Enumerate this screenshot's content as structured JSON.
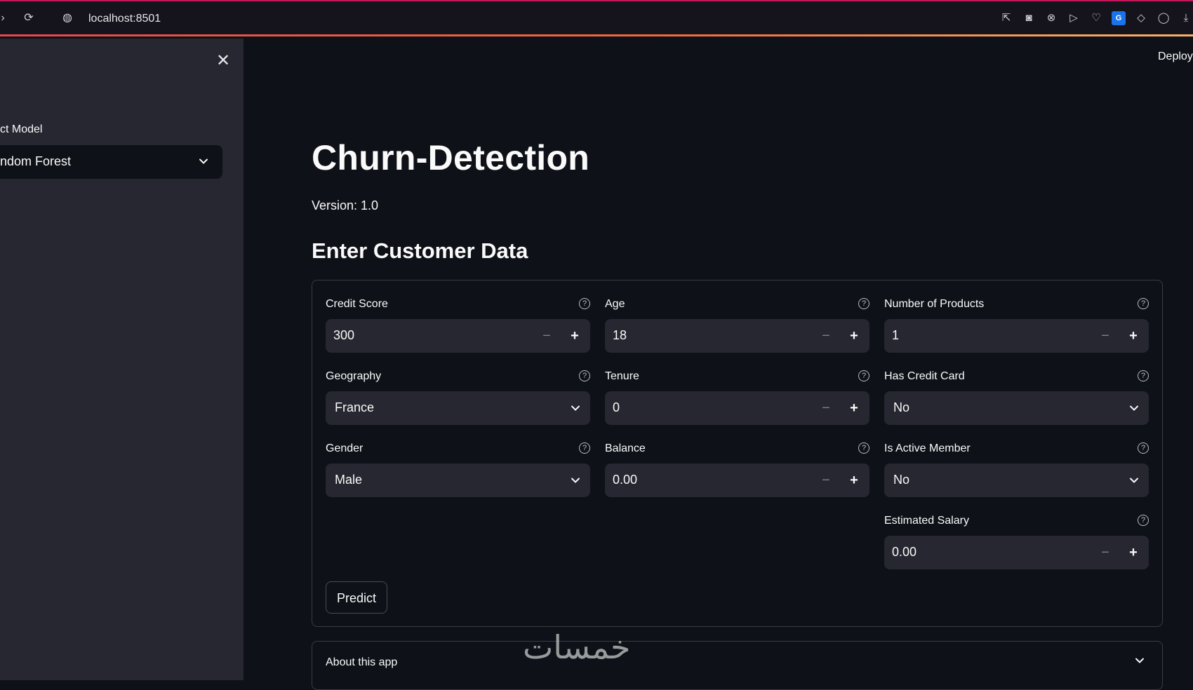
{
  "browser": {
    "url": "localhost:8501"
  },
  "sidebar": {
    "select_label": "ct Model",
    "select_value": "ndom Forest"
  },
  "header": {
    "deploy": "Deploy"
  },
  "main": {
    "title": "Churn-Detection",
    "version": "Version: 1.0",
    "subtitle": "Enter Customer Data",
    "fields": {
      "credit_score": {
        "label": "Credit Score",
        "value": "300"
      },
      "age": {
        "label": "Age",
        "value": "18"
      },
      "num_products": {
        "label": "Number of Products",
        "value": "1"
      },
      "geography": {
        "label": "Geography",
        "value": "France"
      },
      "tenure": {
        "label": "Tenure",
        "value": "0"
      },
      "has_credit_card": {
        "label": "Has Credit Card",
        "value": "No"
      },
      "gender": {
        "label": "Gender",
        "value": "Male"
      },
      "balance": {
        "label": "Balance",
        "value": "0.00"
      },
      "is_active": {
        "label": "Is Active Member",
        "value": "No"
      },
      "salary": {
        "label": "Estimated Salary",
        "value": "0.00"
      }
    },
    "predict_label": "Predict",
    "about_label": "About this app"
  },
  "icons": {
    "help": "question-circle-icon",
    "minus": "minus-icon",
    "plus": "plus-icon",
    "chevron": "chevron-down-icon"
  },
  "colors": {
    "background": "#0e1117",
    "sidebar": "#262730",
    "input": "#262730",
    "accent": "#e5484d"
  },
  "watermark": "خمسات"
}
